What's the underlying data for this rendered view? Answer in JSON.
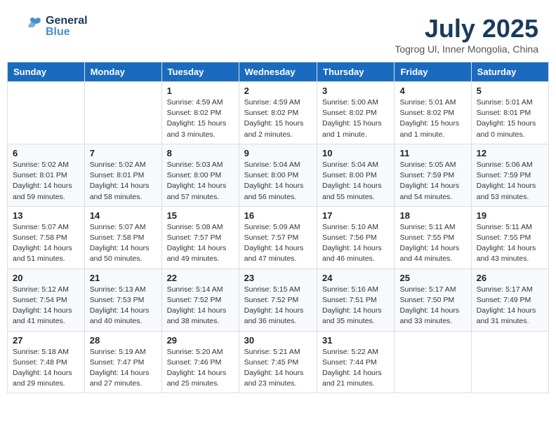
{
  "header": {
    "logo_general": "General",
    "logo_blue": "Blue",
    "month_title": "July 2025",
    "location": "Togrog Ul, Inner Mongolia, China"
  },
  "days_of_week": [
    "Sunday",
    "Monday",
    "Tuesday",
    "Wednesday",
    "Thursday",
    "Friday",
    "Saturday"
  ],
  "weeks": [
    [
      {
        "day": "",
        "info": ""
      },
      {
        "day": "",
        "info": ""
      },
      {
        "day": "1",
        "info": "Sunrise: 4:59 AM\nSunset: 8:02 PM\nDaylight: 15 hours\nand 3 minutes."
      },
      {
        "day": "2",
        "info": "Sunrise: 4:59 AM\nSunset: 8:02 PM\nDaylight: 15 hours\nand 2 minutes."
      },
      {
        "day": "3",
        "info": "Sunrise: 5:00 AM\nSunset: 8:02 PM\nDaylight: 15 hours\nand 1 minute."
      },
      {
        "day": "4",
        "info": "Sunrise: 5:01 AM\nSunset: 8:02 PM\nDaylight: 15 hours\nand 1 minute."
      },
      {
        "day": "5",
        "info": "Sunrise: 5:01 AM\nSunset: 8:01 PM\nDaylight: 15 hours\nand 0 minutes."
      }
    ],
    [
      {
        "day": "6",
        "info": "Sunrise: 5:02 AM\nSunset: 8:01 PM\nDaylight: 14 hours\nand 59 minutes."
      },
      {
        "day": "7",
        "info": "Sunrise: 5:02 AM\nSunset: 8:01 PM\nDaylight: 14 hours\nand 58 minutes."
      },
      {
        "day": "8",
        "info": "Sunrise: 5:03 AM\nSunset: 8:00 PM\nDaylight: 14 hours\nand 57 minutes."
      },
      {
        "day": "9",
        "info": "Sunrise: 5:04 AM\nSunset: 8:00 PM\nDaylight: 14 hours\nand 56 minutes."
      },
      {
        "day": "10",
        "info": "Sunrise: 5:04 AM\nSunset: 8:00 PM\nDaylight: 14 hours\nand 55 minutes."
      },
      {
        "day": "11",
        "info": "Sunrise: 5:05 AM\nSunset: 7:59 PM\nDaylight: 14 hours\nand 54 minutes."
      },
      {
        "day": "12",
        "info": "Sunrise: 5:06 AM\nSunset: 7:59 PM\nDaylight: 14 hours\nand 53 minutes."
      }
    ],
    [
      {
        "day": "13",
        "info": "Sunrise: 5:07 AM\nSunset: 7:58 PM\nDaylight: 14 hours\nand 51 minutes."
      },
      {
        "day": "14",
        "info": "Sunrise: 5:07 AM\nSunset: 7:58 PM\nDaylight: 14 hours\nand 50 minutes."
      },
      {
        "day": "15",
        "info": "Sunrise: 5:08 AM\nSunset: 7:57 PM\nDaylight: 14 hours\nand 49 minutes."
      },
      {
        "day": "16",
        "info": "Sunrise: 5:09 AM\nSunset: 7:57 PM\nDaylight: 14 hours\nand 47 minutes."
      },
      {
        "day": "17",
        "info": "Sunrise: 5:10 AM\nSunset: 7:56 PM\nDaylight: 14 hours\nand 46 minutes."
      },
      {
        "day": "18",
        "info": "Sunrise: 5:11 AM\nSunset: 7:55 PM\nDaylight: 14 hours\nand 44 minutes."
      },
      {
        "day": "19",
        "info": "Sunrise: 5:11 AM\nSunset: 7:55 PM\nDaylight: 14 hours\nand 43 minutes."
      }
    ],
    [
      {
        "day": "20",
        "info": "Sunrise: 5:12 AM\nSunset: 7:54 PM\nDaylight: 14 hours\nand 41 minutes."
      },
      {
        "day": "21",
        "info": "Sunrise: 5:13 AM\nSunset: 7:53 PM\nDaylight: 14 hours\nand 40 minutes."
      },
      {
        "day": "22",
        "info": "Sunrise: 5:14 AM\nSunset: 7:52 PM\nDaylight: 14 hours\nand 38 minutes."
      },
      {
        "day": "23",
        "info": "Sunrise: 5:15 AM\nSunset: 7:52 PM\nDaylight: 14 hours\nand 36 minutes."
      },
      {
        "day": "24",
        "info": "Sunrise: 5:16 AM\nSunset: 7:51 PM\nDaylight: 14 hours\nand 35 minutes."
      },
      {
        "day": "25",
        "info": "Sunrise: 5:17 AM\nSunset: 7:50 PM\nDaylight: 14 hours\nand 33 minutes."
      },
      {
        "day": "26",
        "info": "Sunrise: 5:17 AM\nSunset: 7:49 PM\nDaylight: 14 hours\nand 31 minutes."
      }
    ],
    [
      {
        "day": "27",
        "info": "Sunrise: 5:18 AM\nSunset: 7:48 PM\nDaylight: 14 hours\nand 29 minutes."
      },
      {
        "day": "28",
        "info": "Sunrise: 5:19 AM\nSunset: 7:47 PM\nDaylight: 14 hours\nand 27 minutes."
      },
      {
        "day": "29",
        "info": "Sunrise: 5:20 AM\nSunset: 7:46 PM\nDaylight: 14 hours\nand 25 minutes."
      },
      {
        "day": "30",
        "info": "Sunrise: 5:21 AM\nSunset: 7:45 PM\nDaylight: 14 hours\nand 23 minutes."
      },
      {
        "day": "31",
        "info": "Sunrise: 5:22 AM\nSunset: 7:44 PM\nDaylight: 14 hours\nand 21 minutes."
      },
      {
        "day": "",
        "info": ""
      },
      {
        "day": "",
        "info": ""
      }
    ]
  ]
}
